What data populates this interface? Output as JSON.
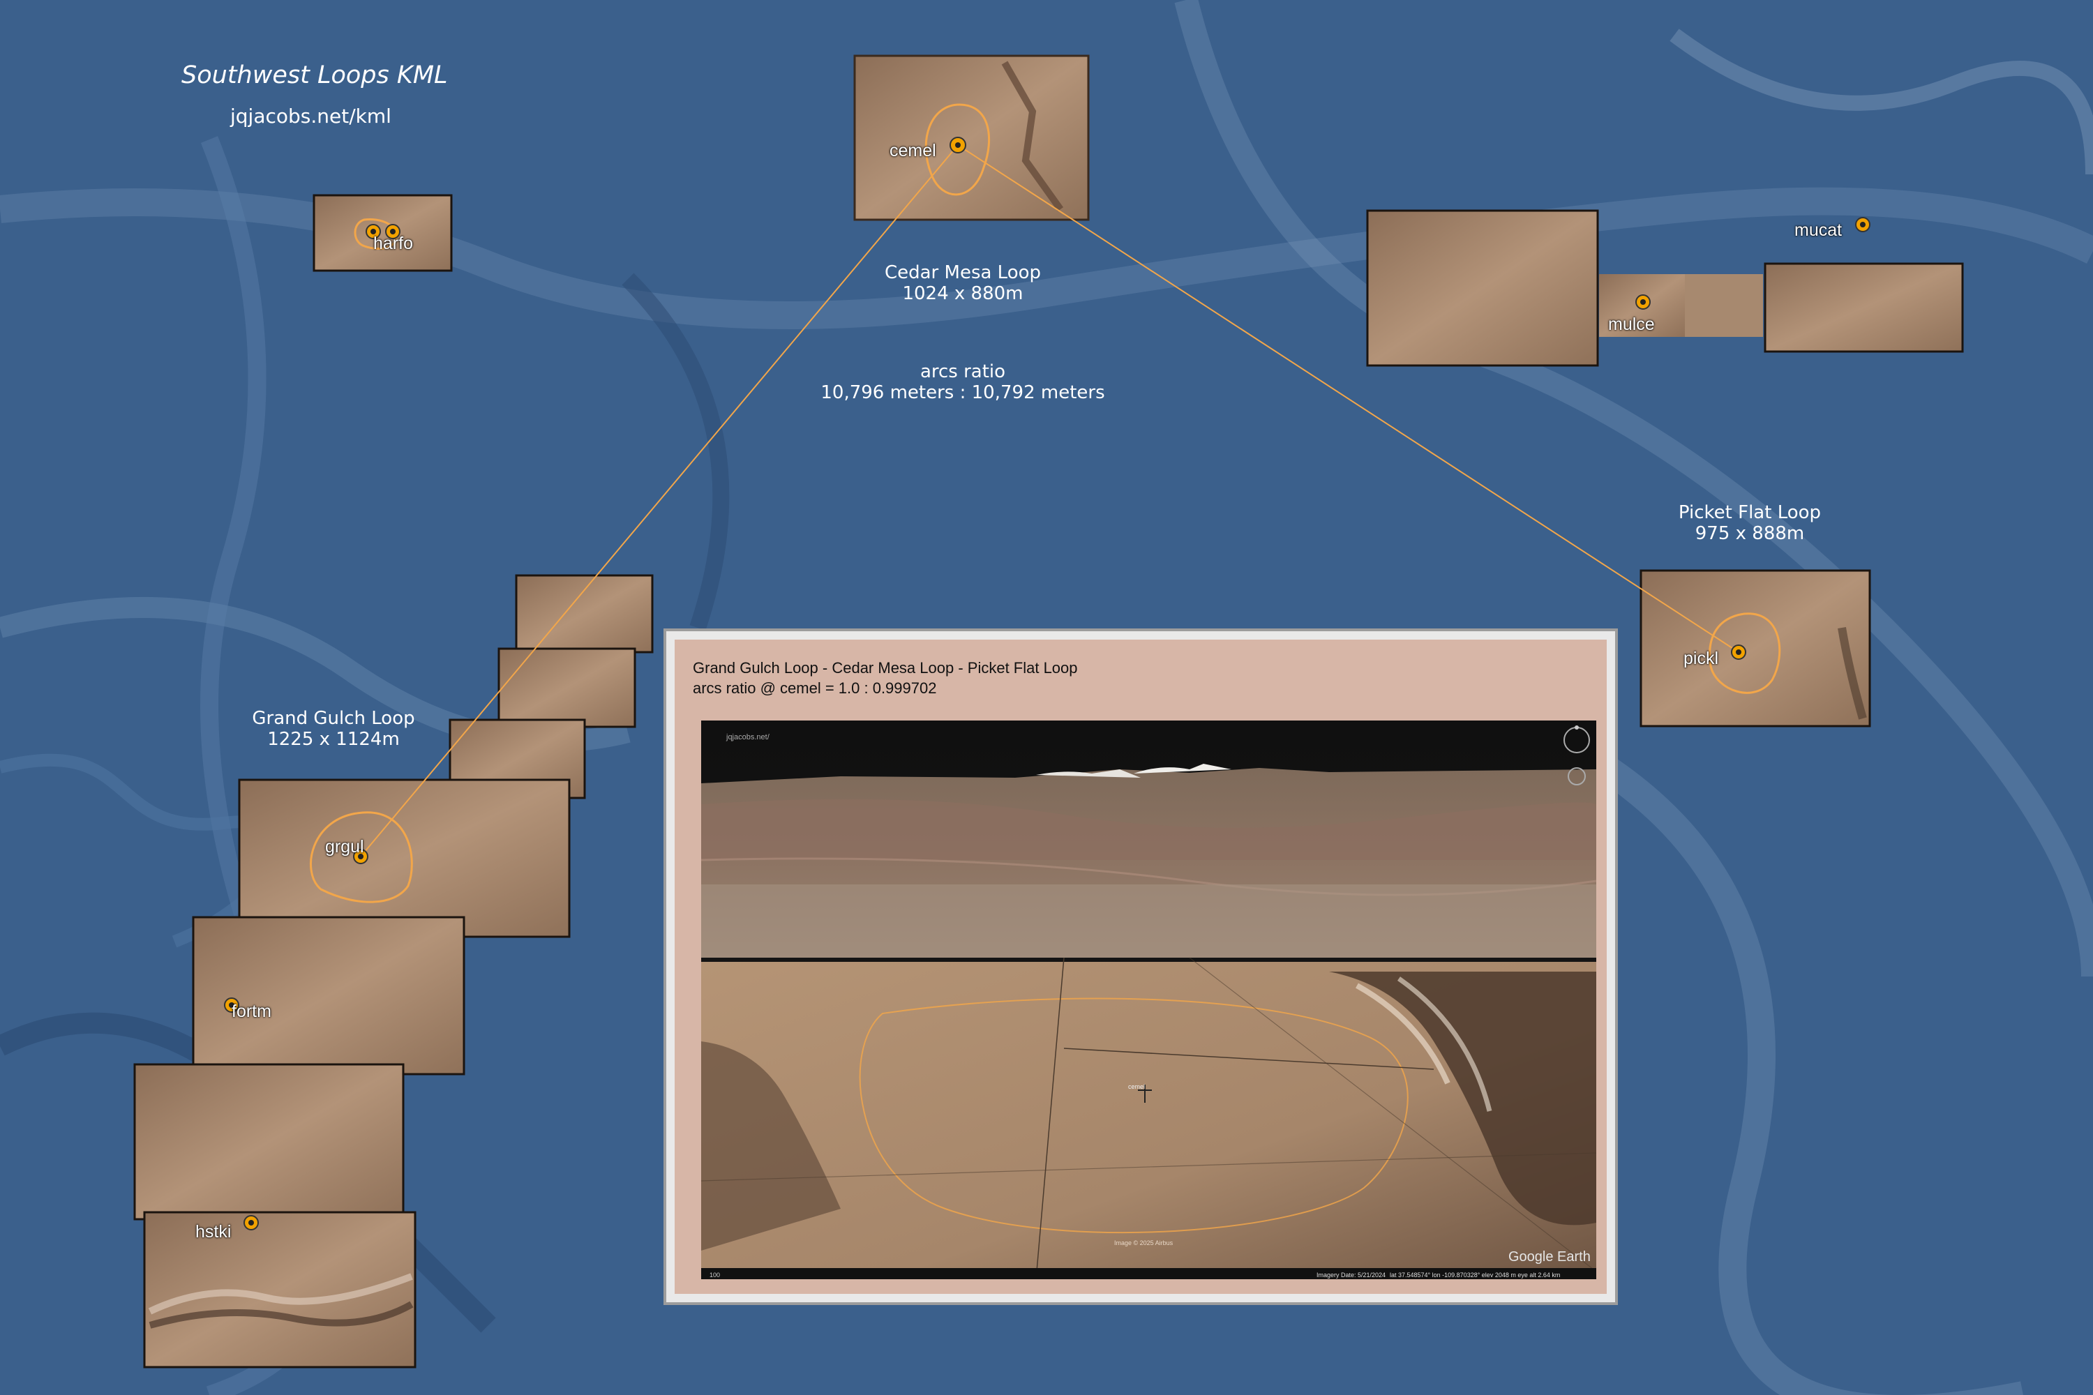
{
  "map": {
    "title": "Southwest Loops KML",
    "url": "jqjacobs.net/kml"
  },
  "loops": [
    {
      "name": "Cedar Mesa Loop",
      "size": "1024 x 880m"
    },
    {
      "name": "Picket Flat Loop",
      "size": "975 x 888m"
    },
    {
      "name": "Grand Gulch Loop",
      "size": "1225 x 1124m"
    }
  ],
  "arcs": {
    "label": "arcs ratio",
    "value": "10,796 meters : 10,792 meters"
  },
  "markers": [
    "cemel",
    "harfo",
    "mucat",
    "mulce",
    "pickl",
    "grgul",
    "fortm",
    "hstki"
  ],
  "inset": {
    "title": "Grand Gulch Loop - Cedar Mesa Loop - Picket Flat Loop",
    "subtitle": "arcs ratio @ cemel = 1.0 : 0.999702",
    "watermark": "jqjacobs.net/",
    "attribution": "Google Earth",
    "center_label": "cemel",
    "imagery_date": "Imagery Date: 5/21/2024",
    "coords": "lat  37.548574°  lon -109.870328°  elev  2048 m     eye alt  2.64 km",
    "image_credit": "Image © 2025 Airbus",
    "scale": "100"
  },
  "colors": {
    "background": "#3a5f8c",
    "terrain": "#a98a70",
    "loop_line": "#f2a64a",
    "marker": "#f2a200"
  }
}
